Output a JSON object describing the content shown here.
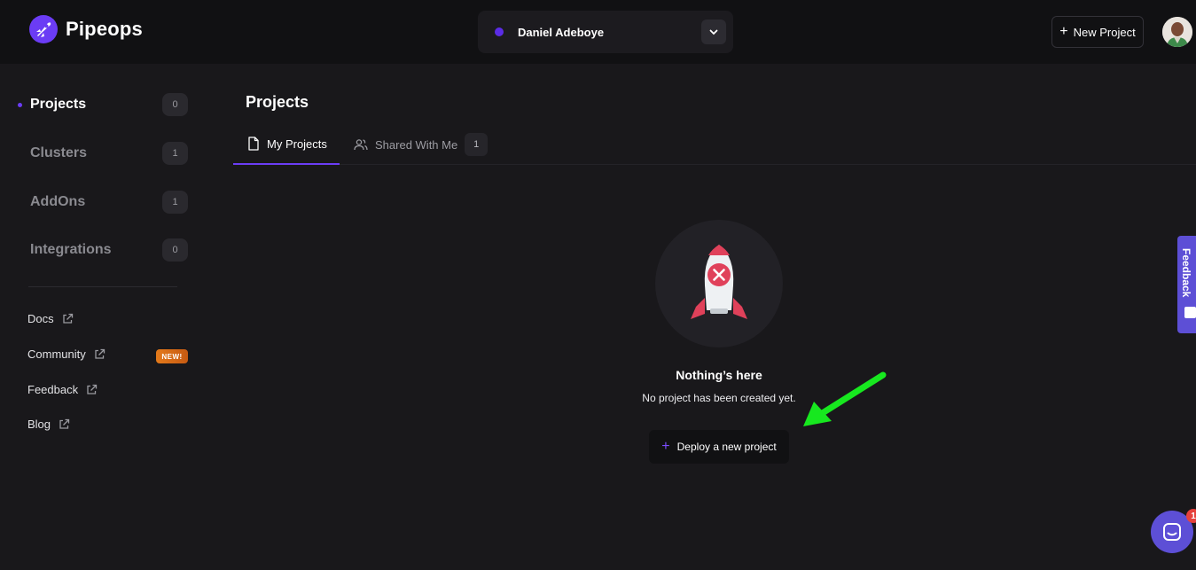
{
  "header": {
    "brand": "Pipeops",
    "workspace_name": "Daniel Adeboye",
    "new_project_label": "New Project",
    "accent": "#5b2ce6"
  },
  "sidebar": {
    "items": [
      {
        "label": "Projects",
        "count": "0",
        "active": true
      },
      {
        "label": "Clusters",
        "count": "1"
      },
      {
        "label": "AddOns",
        "count": "1"
      },
      {
        "label": "Integrations",
        "count": "0"
      }
    ],
    "links": [
      {
        "label": "Docs"
      },
      {
        "label": "Community",
        "badge": "NEW!"
      },
      {
        "label": "Feedback"
      },
      {
        "label": "Blog"
      }
    ]
  },
  "main": {
    "title": "Projects",
    "tabs": [
      {
        "label": "My Projects",
        "active": true
      },
      {
        "label": "Shared With Me",
        "count": "1"
      }
    ],
    "empty_state": {
      "title": "Nothing’s here",
      "subtitle": "No project has been created yet.",
      "cta": "Deploy a new project"
    }
  },
  "feedback_tab": {
    "label": "Feedback"
  },
  "chat": {
    "badge": "1"
  },
  "annotation": {
    "arrow_color": "#17e81f"
  }
}
